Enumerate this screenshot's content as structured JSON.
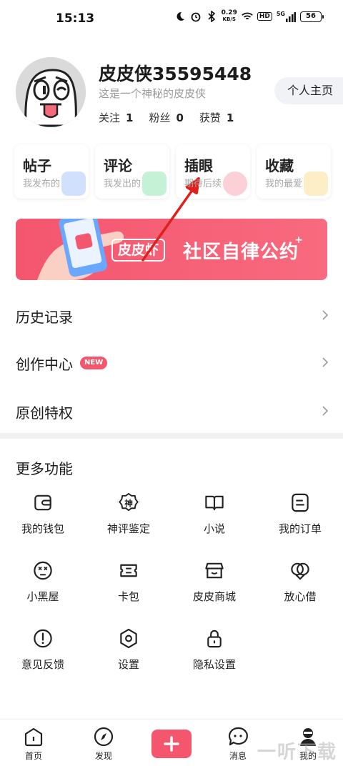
{
  "status_bar": {
    "time": "15:13",
    "net_speed_value": "0.29",
    "net_speed_unit": "KB/S",
    "hd": "HD",
    "signal_label": "5G",
    "battery": "56"
  },
  "profile": {
    "username": "皮皮侠35595448",
    "signature": "这是一个神秘的皮皮侠",
    "stats": [
      {
        "label": "关注",
        "value": "1"
      },
      {
        "label": "粉丝",
        "value": "0"
      },
      {
        "label": "获赞",
        "value": "1"
      }
    ],
    "homepage_button": "个人主页"
  },
  "cards": [
    {
      "title": "帖子",
      "subtitle": "我发布的",
      "deco_color": "#5b8ef5"
    },
    {
      "title": "评论",
      "subtitle": "我发出的",
      "deco_color": "#2fcf6b"
    },
    {
      "title": "插眼",
      "subtitle": "期待后续",
      "deco_color": "#f4566e"
    },
    {
      "title": "收藏",
      "subtitle": "我的最爱",
      "deco_color": "#f7c23a"
    }
  ],
  "banner": {
    "logo_text": "皮皮虾",
    "text": "社区自律公约",
    "plus": "+"
  },
  "menu": [
    {
      "label": "历史记录"
    },
    {
      "label": "创作中心",
      "badge": "NEW"
    },
    {
      "label": "原创特权"
    }
  ],
  "more": {
    "title": "更多功能",
    "items": [
      {
        "label": "我的钱包",
        "icon": "wallet-icon"
      },
      {
        "label": "神评鉴定",
        "icon": "shen-badge-icon",
        "glyph": "神"
      },
      {
        "label": "小说",
        "icon": "book-icon"
      },
      {
        "label": "我的订单",
        "icon": "order-icon"
      },
      {
        "label": "小黑屋",
        "icon": "dizzy-face-icon"
      },
      {
        "label": "卡包",
        "icon": "card-icon"
      },
      {
        "label": "皮皮商城",
        "icon": "store-icon"
      },
      {
        "label": "放心借",
        "icon": "loan-icon"
      },
      {
        "label": "意见反馈",
        "icon": "feedback-icon"
      },
      {
        "label": "设置",
        "icon": "settings-icon"
      },
      {
        "label": "隐私设置",
        "icon": "lock-icon"
      }
    ]
  },
  "tabbar": {
    "tabs": [
      {
        "label": "首页",
        "icon": "home-icon"
      },
      {
        "label": "发现",
        "icon": "compass-icon"
      },
      {
        "label": "消息",
        "icon": "message-icon"
      },
      {
        "label": "我的",
        "icon": "profile-icon"
      }
    ],
    "post_icon": "plus-icon"
  },
  "watermark": "一听下载",
  "colors": {
    "accent": "#f4566e",
    "text": "#222222",
    "muted": "#9a9a9a"
  }
}
